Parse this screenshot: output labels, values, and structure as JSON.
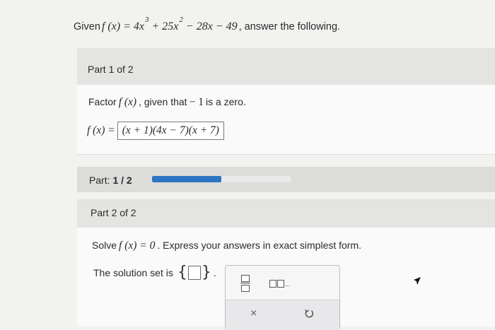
{
  "question": {
    "prefix": "Given",
    "function": "f (x) = 4x",
    "exp3": "3",
    "term2": "+ 25x",
    "exp2": "2",
    "rest": "− 28x − 49",
    "suffix": ", answer the following."
  },
  "part1": {
    "header": "Part 1 of 2",
    "prompt_before": "Factor",
    "prompt_fx": "f (x)",
    "prompt_middle": ", given that",
    "prompt_value": "− 1",
    "prompt_after": "is a zero.",
    "answer_lhs": "f (x) =",
    "answer_value": "(x + 1)(4x − 7)(x + 7)"
  },
  "progress": {
    "label": "Part:",
    "value_text": "1 / 2",
    "fraction": 0.5,
    "fill_color": "#2c74c4"
  },
  "part2": {
    "header": "Part 2 of 2",
    "prompt_before": "Solve",
    "prompt_eq": "f (x) = 0",
    "prompt_after": ". Express your answers in exact simplest form.",
    "solution_label": "The solution set is",
    "brace_open": "{",
    "brace_close": "}",
    "period": ".",
    "solution_value": ""
  },
  "palette": {
    "list_text": "...",
    "clear_symbol": "×"
  },
  "icons": {
    "fraction": "fraction-template-icon",
    "list": "list-template-icon",
    "clear": "close-icon",
    "undo": "undo-icon",
    "cursor": "mouse-cursor-icon"
  }
}
